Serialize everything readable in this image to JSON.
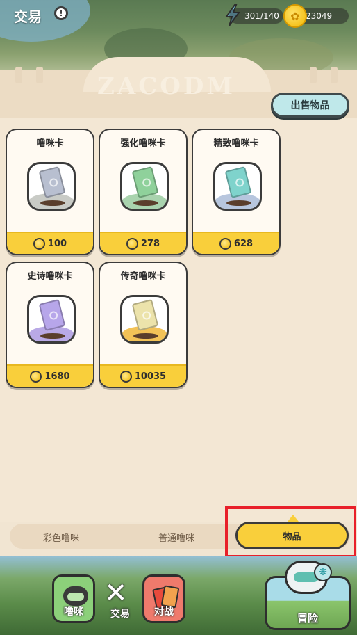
{
  "header": {
    "title": "交易",
    "info_label": "!",
    "energy": "301/140",
    "coins": "23049"
  },
  "banner": {
    "deco_text": "ZACODM"
  },
  "sell_button": "出售物品",
  "items": [
    {
      "name": "噜咪卡",
      "price": "100",
      "card_color": "#b8bfd0",
      "ground_color": "#c9cbc6"
    },
    {
      "name": "强化噜咪卡",
      "price": "278",
      "card_color": "#8fd19b",
      "ground_color": "#a9d3ae"
    },
    {
      "name": "精致噜咪卡",
      "price": "628",
      "card_color": "#7fd3cc",
      "ground_color": "#b7c6de"
    },
    {
      "name": "史诗噜咪卡",
      "price": "1680",
      "card_color": "#b7a6ea",
      "ground_color": "#b9a9e6"
    },
    {
      "name": "传奇噜咪卡",
      "price": "10035",
      "card_color": "#ece3ab",
      "ground_color": "#f2c257"
    }
  ],
  "tabs": [
    {
      "label": "彩色噜咪",
      "active": false
    },
    {
      "label": "普通噜咪",
      "active": false
    },
    {
      "label": "物品",
      "active": true
    }
  ],
  "nav": {
    "mimi": "噜咪",
    "trade": "交易",
    "battle": "对战",
    "adventure": "冒险"
  },
  "colors": {
    "accent_yellow": "#f9cf3b",
    "sell_button_bg": "#bfe8ea",
    "highlight_red": "#e8202a",
    "panel_bg": "#f3e7d4"
  }
}
